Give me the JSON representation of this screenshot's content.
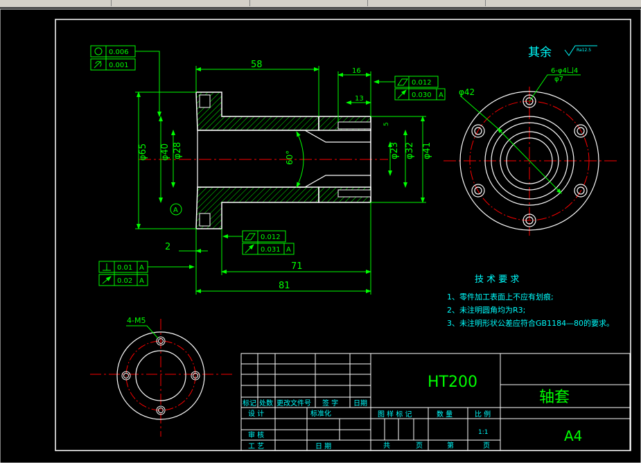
{
  "colors": {
    "background": "#000000",
    "frame": "#ffffff",
    "dimension": "#00ff00",
    "outline": "#ffffff",
    "centerline": "#ff0000",
    "hatch": "#00ff00",
    "text_cyan": "#00ffff",
    "text_green": "#00ff00"
  },
  "drawing": {
    "surface_note": {
      "label": "其余",
      "roughness": "Ra12.5"
    },
    "side_view": {
      "dims": {
        "d58": "58",
        "d16": "16",
        "d13": "13",
        "d5": "5",
        "phi65": "φ65",
        "phi40": "φ40",
        "phi28": "φ28",
        "phi23": "φ23",
        "phi32": "φ32",
        "phi41": "φ41",
        "angle": "60°",
        "d2": "2",
        "d71": "71",
        "d81": "81"
      },
      "datum": "A",
      "gdt_top_left": [
        {
          "symbol": "circularity",
          "value": "0.006"
        },
        {
          "symbol": "cylindricity",
          "value": "0.001"
        }
      ],
      "gdt_top_right": [
        {
          "symbol": "flatness",
          "value": "0.012"
        },
        {
          "symbol": "runout",
          "value": "0.030",
          "datum": "A"
        }
      ],
      "gdt_mid": [
        {
          "symbol": "flatness",
          "value": "0.012"
        },
        {
          "symbol": "runout",
          "value": "0.031",
          "datum": "A"
        }
      ],
      "gdt_left": [
        {
          "symbol": "perpendicularity",
          "value": "0.01",
          "datum": "A"
        },
        {
          "symbol": "runout",
          "value": "0.02",
          "datum": "A"
        }
      ]
    },
    "front_view": {
      "phi42": "φ42",
      "holes_note": "6-φ4凵4",
      "hole_depth": "φ7"
    },
    "bottom_view": {
      "note": "4-M5"
    },
    "tech_requirements": {
      "title": "技 术 要 求",
      "items": [
        "1、零件加工表面上不应有划痕;",
        "2、未注明圆角均为R3;",
        "3、未注明形状公差应符合GB1184—80的要求。"
      ]
    },
    "title_block": {
      "material": "HT200",
      "part_name": "轴套",
      "sheet_size": "A4",
      "revision_headers": [
        "标记",
        "处数",
        "更改文件号",
        "签 字",
        "日期"
      ],
      "labels": {
        "design": "设 计",
        "standardize": "标准化",
        "review": "审 核",
        "process": "工 艺",
        "date": "日 期",
        "drawing_mark": "图 样 标 记",
        "quantity": "数 量",
        "scale": "比 例",
        "scale_value": "1:1",
        "total": "共",
        "page": "页",
        "sheet": "第",
        "page2": "页"
      }
    }
  }
}
